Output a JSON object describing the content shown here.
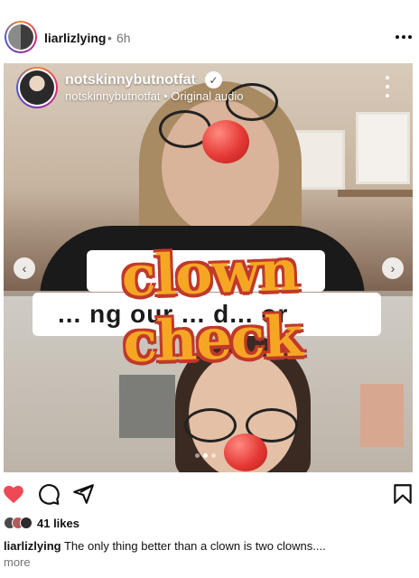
{
  "post": {
    "username": "liarlizlying",
    "separator": "•",
    "time": "6h"
  },
  "reel": {
    "username": "notskinnybutnotfat",
    "subtitle": "notskinnybutnotfat • Original audio",
    "caption_partial": "... ng our ... d... or",
    "overlay_title": "clown check",
    "carousel": {
      "count": 3,
      "active_index": 1
    }
  },
  "engagement": {
    "likes": "41 likes",
    "liked": true
  },
  "caption": {
    "username": "liarlizlying",
    "text": "The only thing better than a clown is two clowns....",
    "more": "more"
  },
  "icons": {
    "like": "heart-icon",
    "comment": "comment-icon",
    "share": "share-icon",
    "save": "bookmark-icon",
    "more": "more-options-icon",
    "verified": "verified-badge-icon",
    "prev": "chevron-left-icon",
    "next": "chevron-right-icon"
  },
  "colors": {
    "like_red": "#ed4956",
    "overlay_orange": "#f5a623",
    "overlay_outline": "#c0392b"
  }
}
